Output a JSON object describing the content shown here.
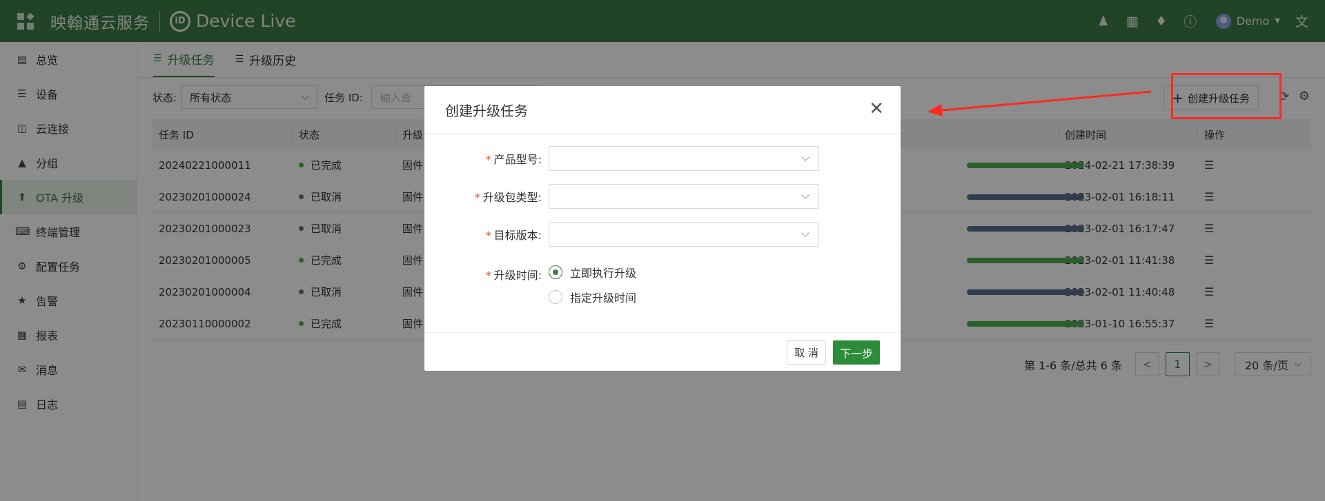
{
  "app": {
    "brand": "映翰通云服务",
    "product": "Device Live",
    "logo_glyph": "iD"
  },
  "topbar": {
    "icons": [
      "user-admin-icon",
      "building-icon",
      "bell-icon",
      "help-icon"
    ],
    "user_name": "Demo",
    "lang_icon": "translate-icon"
  },
  "sidebar": {
    "items": [
      {
        "label": "总览",
        "icon": "dashboard-icon"
      },
      {
        "label": "设备",
        "icon": "device-icon"
      },
      {
        "label": "云连接",
        "icon": "cloud-connect-icon"
      },
      {
        "label": "分组",
        "icon": "group-icon"
      },
      {
        "label": "OTA 升级",
        "icon": "upgrade-icon",
        "active": true
      },
      {
        "label": "终端管理",
        "icon": "terminal-icon"
      },
      {
        "label": "配置任务",
        "icon": "config-icon"
      },
      {
        "label": "告警",
        "icon": "alarm-icon"
      },
      {
        "label": "报表",
        "icon": "report-icon"
      },
      {
        "label": "消息",
        "icon": "message-icon"
      },
      {
        "label": "日志",
        "icon": "log-icon"
      }
    ]
  },
  "tabs": [
    {
      "label": "升级任务",
      "active": true
    },
    {
      "label": "升级历史",
      "active": false
    }
  ],
  "filters": {
    "status_label": "状态:",
    "status_value": "所有状态",
    "task_id_label": "任务 ID:",
    "task_id_placeholder": "输入查",
    "create_button": "创建升级任务"
  },
  "table": {
    "headers": {
      "id": "任务 ID",
      "status": "状态",
      "type": "升级",
      "time": "创建时间",
      "op": "操作"
    },
    "rows": [
      {
        "id": "20240221000011",
        "status": "已完成",
        "type": "固件",
        "time": "2024-02-21 17:38:39",
        "color": "#4caf50"
      },
      {
        "id": "20230201000024",
        "status": "已取消",
        "type": "固件",
        "time": "2023-02-01 16:18:11",
        "color": "#5a6e8f"
      },
      {
        "id": "20230201000023",
        "status": "已取消",
        "type": "固件",
        "time": "2023-02-01 16:17:47",
        "color": "#5a6e8f"
      },
      {
        "id": "20230201000005",
        "status": "已完成",
        "type": "固件",
        "time": "2023-02-01 11:41:38",
        "color": "#4caf50"
      },
      {
        "id": "20230201000004",
        "status": "已取消",
        "type": "固件",
        "time": "2023-02-01 11:40:48",
        "color": "#5a6e8f"
      },
      {
        "id": "20230110000002",
        "status": "已完成",
        "type": "固件",
        "time": "2023-01-10 16:55:37",
        "color": "#4caf50"
      }
    ]
  },
  "pager": {
    "info": "第 1-6 条/总共 6 条",
    "prev": "<",
    "current": "1",
    "next": ">",
    "page_size": "20 条/页"
  },
  "modal": {
    "title": "创建升级任务",
    "fields": {
      "product_model": "产品型号:",
      "package_type": "升级包类型:",
      "target_version": "目标版本:",
      "upgrade_time": "升级时间:"
    },
    "required_mark": "*",
    "radio_now": "立即执行升级",
    "radio_scheduled": "指定升级时间",
    "cancel": "取 消",
    "next": "下一步"
  },
  "colors": {
    "brand_green": "#3d7c46",
    "annotation_red": "#ff2a1f"
  }
}
